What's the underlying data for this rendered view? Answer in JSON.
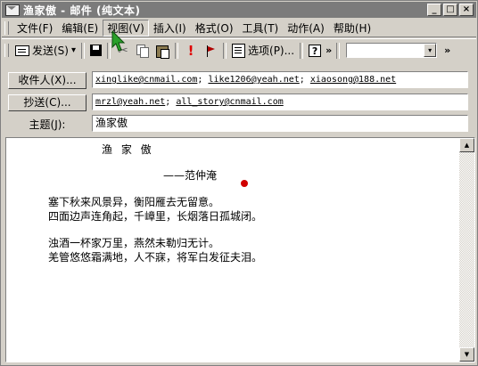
{
  "window": {
    "title": "渔家傲 - 邮件 (纯文本)",
    "controls": {
      "minimize": "_",
      "maximize": "□",
      "close": "×"
    }
  },
  "menu": {
    "items": [
      "文件(F)",
      "编辑(E)",
      "视图(V)",
      "插入(I)",
      "格式(O)",
      "工具(T)",
      "动作(A)",
      "帮助(H)"
    ],
    "open_item": "视图(V)"
  },
  "toolbar": {
    "send_label": "发送(S)",
    "send_dropdown": "▾",
    "options_label": "选项(P)...",
    "help_icon": "?",
    "overflow": "»",
    "combo_value": "",
    "combo_arrow": "▾",
    "icons": [
      "send-icon",
      "save-icon",
      "cut-icon",
      "copy-icon",
      "paste-icon",
      "importance-icon",
      "flag-icon",
      "options-icon",
      "help-icon"
    ]
  },
  "header": {
    "to_label": "收件人(X)...",
    "to_addresses": [
      "xinglike@cnmail.com",
      "like1206@yeah.net",
      "xiaosong@188.net"
    ],
    "cc_label": "抄送(C)...",
    "cc_addresses": [
      "mrzl@yeah.net",
      "all_story@cnmail.com"
    ],
    "subject_label": "主题(J):",
    "subject_value": "渔家傲"
  },
  "body": {
    "title": "渔 家 傲",
    "author": "——范仲淹",
    "lines": [
      "塞下秋来风景异，衡阳雁去无留意。",
      "四面边声连角起，千嶂里，长烟落日孤城闭。",
      "浊酒一杯家万里，燕然未勒归无计。",
      "羌管悠悠霜满地，人不寐，将军白发征夫泪。"
    ]
  },
  "scrollbar": {
    "up_arrow": "▲",
    "down_arrow": "▼"
  }
}
